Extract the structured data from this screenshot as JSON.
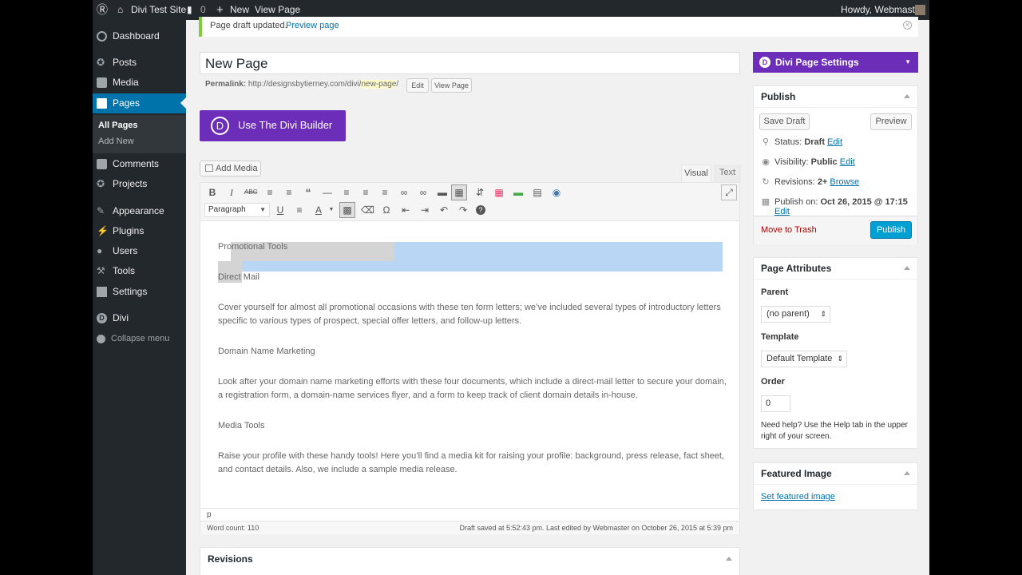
{
  "adminbar": {
    "site": "Divi Test Site",
    "comments": "0",
    "new": "New",
    "view": "View Page",
    "howdy": "Howdy, Webmaster"
  },
  "sidebar": {
    "items": [
      {
        "label": "Dashboard",
        "icon": "dashboard-icon"
      },
      {
        "label": "Posts",
        "icon": "pin-icon"
      },
      {
        "label": "Media",
        "icon": "media-icon"
      },
      {
        "label": "Pages",
        "icon": "pages-icon"
      },
      {
        "label": "Comments",
        "icon": "comment-icon"
      },
      {
        "label": "Projects",
        "icon": "pin-icon"
      },
      {
        "label": "Appearance",
        "icon": "brush-icon"
      },
      {
        "label": "Plugins",
        "icon": "plug-icon"
      },
      {
        "label": "Users",
        "icon": "user-icon"
      },
      {
        "label": "Tools",
        "icon": "wrench-icon"
      },
      {
        "label": "Settings",
        "icon": "settings-icon"
      },
      {
        "label": "Divi",
        "icon": "divi-icon"
      }
    ],
    "sub": [
      "All Pages",
      "Add New"
    ],
    "collapse": "Collapse menu"
  },
  "notice": {
    "text": "Page draft updated.",
    "link": "Preview page"
  },
  "title": "New Page",
  "permalink": {
    "label": "Permalink:",
    "base": "http://designsbytierney.com/divi/",
    "slug": "new-page",
    "slash": "/",
    "edit": "Edit",
    "view": "View Page"
  },
  "divi_builder": "Use The Divi Builder",
  "add_media": "Add Media",
  "tabs": {
    "visual": "Visual",
    "text": "Text"
  },
  "format": "Paragraph",
  "content": [
    "Promotional Tools",
    "Direct Mail",
    "Cover yourself for almost all promotional occasions with these ten form letters; we’ve included several types of introductory letters specific to various types of prospect, special offer letters, and follow-up letters.",
    "Domain Name Marketing",
    "Look after your domain name marketing efforts with these four documents, which include a direct-mail letter to secure your domain, a registration form, a domain-name services flyer, and a form to keep track of client domain details in-house.",
    "Media Tools",
    "Raise your profile with these handy tools! Here you’ll find a media kit for raising your profile: background, press release, fact sheet, and contact details. Also, we include a sample media release."
  ],
  "path": "p",
  "word_count": "Word count: 110",
  "draft_saved": "Draft saved at 5:52:43 pm. Last edited by Webmaster on October 26, 2015 at 5:39 pm",
  "revisions_box": "Revisions",
  "divi_settings": "Divi Page Settings",
  "publish": {
    "title": "Publish",
    "save_draft": "Save Draft",
    "preview": "Preview",
    "status_label": "Status:",
    "status": "Draft",
    "visibility_label": "Visibility:",
    "visibility": "Public",
    "revisions_label": "Revisions:",
    "revisions": "2+",
    "browse": "Browse",
    "publish_on_label": "Publish on:",
    "publish_on": "Oct 26, 2015 @ 17:15",
    "edit": "Edit",
    "trash": "Move to Trash",
    "publish_btn": "Publish"
  },
  "attributes": {
    "title": "Page Attributes",
    "parent_label": "Parent",
    "parent": "(no parent)",
    "template_label": "Template",
    "template": "Default Template",
    "order_label": "Order",
    "order": "0",
    "help": "Need help? Use the Help tab in the upper right of your screen."
  },
  "featured": {
    "title": "Featured Image",
    "link": "Set featured image"
  },
  "colors": {
    "adminbar": "#23282d",
    "active": "#0073aa",
    "divi": "#6c2eb9",
    "publish": "#00a0d2"
  }
}
